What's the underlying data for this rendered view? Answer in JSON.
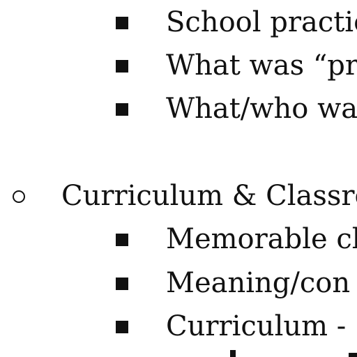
{
  "outline": {
    "items": [
      {
        "level": 2,
        "text": "School practic"
      },
      {
        "level": 2,
        "text": "What was “pr"
      },
      {
        "level": 2,
        "text": "What/who wa"
      },
      {
        "level": 1,
        "text": "Curriculum & Classro"
      },
      {
        "level": 2,
        "text": "Memorable cl"
      },
      {
        "level": 2,
        "text": "Meaning/con"
      },
      {
        "level": 2,
        "text": "Curriculum - "
      }
    ]
  }
}
